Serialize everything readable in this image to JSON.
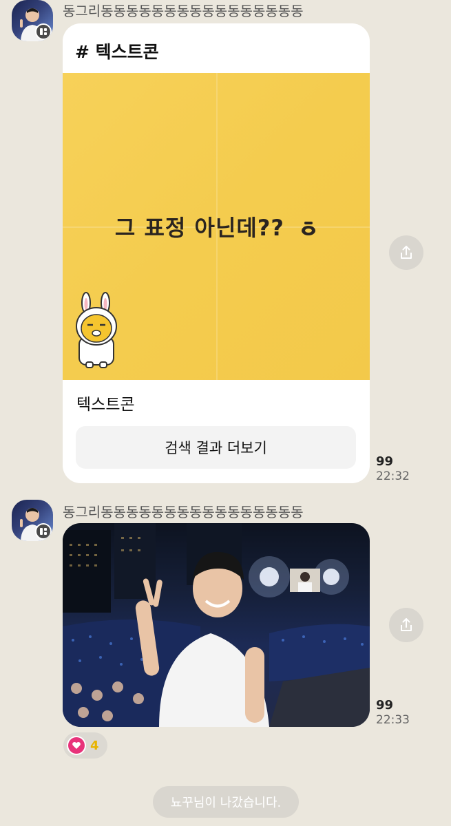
{
  "messages": [
    {
      "sender": "동그리동동동동동동동동동동동동동동동동",
      "card": {
        "header": "# 텍스트콘",
        "emoticon_text": "그 표정 아닌데??",
        "title": "텍스트콘",
        "button_label": "검색 결과 더보기"
      },
      "unread": "99",
      "time": "22:32"
    },
    {
      "sender": "동그리동동동동동동동동동동동동동동동동",
      "unread": "99",
      "time": "22:33",
      "reaction": {
        "icon": "heart-icon",
        "count": "4"
      }
    }
  ],
  "system_message": "뇨꾸님이 나갔습니다.",
  "colors": {
    "background": "#ebe7dd",
    "emoticon_bg": "#f4cc4e",
    "reaction_count": "#e8b400",
    "heart": "#e8337a"
  }
}
